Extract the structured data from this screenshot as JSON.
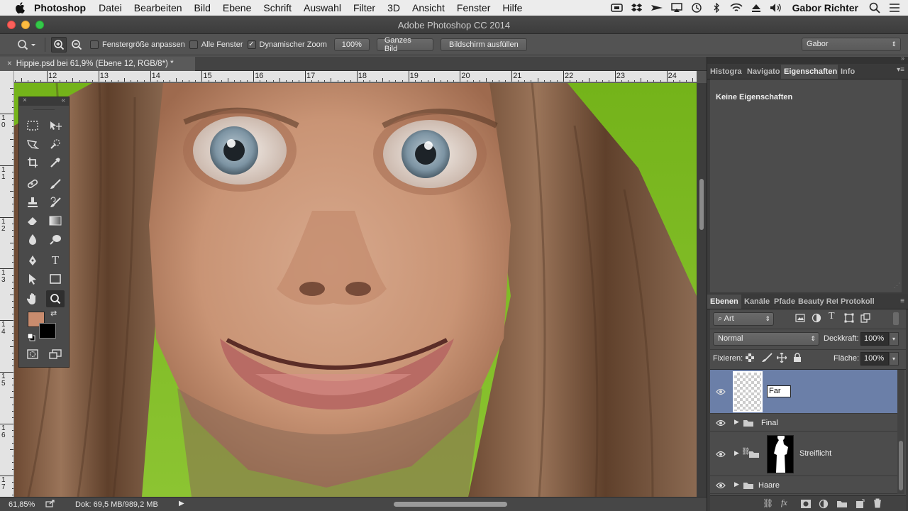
{
  "menubar": {
    "app": "Photoshop",
    "items": [
      "Datei",
      "Bearbeiten",
      "Bild",
      "Ebene",
      "Schrift",
      "Auswahl",
      "Filter",
      "3D",
      "Ansicht",
      "Fenster",
      "Hilfe"
    ],
    "user": "Gabor Richter"
  },
  "window": {
    "title": "Adobe Photoshop CC 2014"
  },
  "options": {
    "fit_window_label": "Fenstergröße anpassen",
    "fit_window_checked": false,
    "all_windows_label": "Alle Fenster",
    "all_windows_checked": false,
    "dynamic_zoom_label": "Dynamischer Zoom",
    "dynamic_zoom_checked": true,
    "zoom_100_label": "100%",
    "fit_screen_label": "Ganzes Bild",
    "fill_screen_label": "Bildschirm ausfüllen",
    "workspace": "Gabor"
  },
  "document": {
    "tab_title": "Hippie.psd bei 61,9% (Ebene 12, RGB/8*) *",
    "ruler_h": [
      "12",
      "13",
      "14",
      "15",
      "16",
      "17",
      "18",
      "19",
      "20",
      "21",
      "22",
      "23",
      "24"
    ],
    "ruler_v": [
      "1\n0",
      "1\n1",
      "1\n2",
      "1\n3",
      "1\n4",
      "1\n5",
      "1\n6",
      "1\n7"
    ]
  },
  "status": {
    "zoom": "61,85%",
    "doc_size": "Dok: 69,5 MB/989,2 MB"
  },
  "props_panel": {
    "tabs": [
      "Histogra",
      "Navigato",
      "Eigenschaften",
      "Info"
    ],
    "active_tab": "Eigenschaften",
    "message": "Keine Eigenschaften"
  },
  "layers_panel": {
    "tabs": [
      "Ebenen",
      "Kanäle",
      "Pfade",
      "Beauty Ret",
      "Protokoll"
    ],
    "active_tab": "Ebenen",
    "filter_kind": "Art",
    "blend_mode": "Normal",
    "opacity_label": "Deckkraft:",
    "opacity": "100%",
    "lock_label": "Fixieren:",
    "fill_label": "Fläche:",
    "fill": "100%",
    "editing_name": "Far",
    "layers": [
      "Final",
      "Streiflicht",
      "Haare"
    ]
  },
  "colors": {
    "foreground": "#c98c6e",
    "background": "#000000",
    "selected_layer": "#6b7fa8"
  }
}
